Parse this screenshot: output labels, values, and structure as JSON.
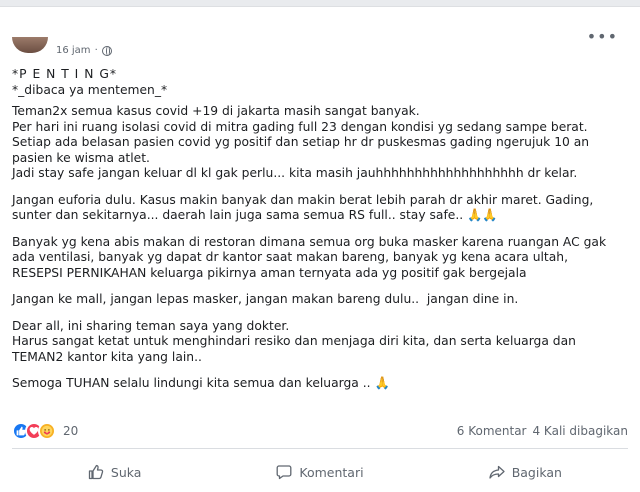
{
  "post": {
    "time": "16 jam",
    "separator": "·",
    "lines": [
      "*P E N T I N G*",
      "*_dibaca ya mentemen_*",
      "",
      "Teman2x semua kasus covid +19 di jakarta masih sangat banyak.",
      "Per hari ini ruang isolasi covid di mitra gading full 23 dengan kondisi yg sedang sampe berat.",
      "Setiap ada belasan pasien covid yg positif dan setiap hr dr puskesmas gading ngerujuk 10 an pasien ke wisma atlet.",
      "Jadi stay safe jangan keluar dl kl gak perlu... kita masih jauhhhhhhhhhhhhhhhhhhh dr kelar.",
      "",
      "Jangan euforia dulu. Kasus makin banyak dan makin berat lebih parah dr akhir maret. Gading, sunter dan sekitarnya... daerah lain juga sama semua RS full.. stay safe.. 🙏🙏",
      "",
      "Banyak yg kena abis makan di restoran dimana semua org buka masker karena ruangan AC gak ada ventilasi, banyak yg dapat dr kantor saat makan bareng, banyak yg kena acara ultah, RESEPSI PERNIKAHAN keluarga pikirnya aman ternyata ada yg positif gak bergejala",
      "",
      "Jangan ke mall, jangan lepas masker, jangan makan bareng dulu..  jangan dine in.",
      "",
      "Dear all, ini sharing teman saya yang dokter.",
      "Harus sangat ketat untuk menghindari resiko dan menjaga diri kita, dan serta keluarga dan TEMAN2 kantor kita yang lain..",
      "",
      "Semoga TUHAN selalu lindungi kita semua dan keluarga .. 🙏"
    ]
  },
  "stats": {
    "reactions_count": "20",
    "comments": "6 Komentar",
    "shares": "4 Kali dibagikan"
  },
  "actions": {
    "like": "Suka",
    "comment": "Komentari",
    "share": "Bagikan"
  },
  "icons": {
    "more": "more-options-icon",
    "privacy": "globe-icon",
    "like": "thumbs-up-icon",
    "comment": "comment-bubble-icon",
    "share": "share-arrow-icon"
  },
  "colors": {
    "like": "#1877f2",
    "love": "#f33e58",
    "care": "#f7b125",
    "muted": "#606770"
  }
}
